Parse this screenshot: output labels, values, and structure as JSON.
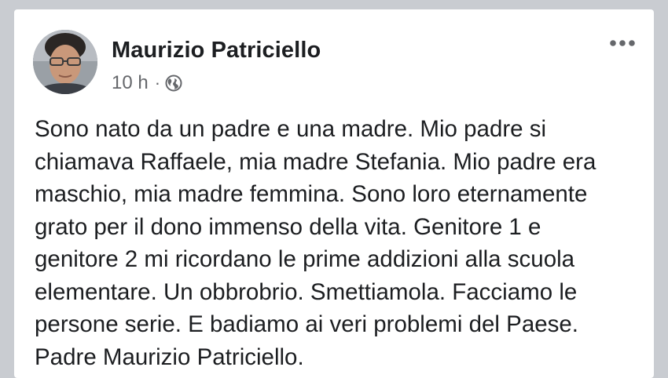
{
  "post": {
    "author": "Maurizio Patriciello",
    "timestamp": "10 h",
    "separator": "·",
    "audience_icon": "globe-icon",
    "more_icon": "more-options-icon",
    "avatar_icon": "profile-photo",
    "text_lines": [
      "Sono nato da un padre e una madre. Mio padre si",
      "chiamava Raffaele, mia madre Stefania. Mio padre era",
      "maschio, mia madre femmina. Sono loro eternamente",
      "grato per il dono immenso della vita. Genitore 1 e",
      "genitore 2 mi ricordano le prime addizioni alla scuola",
      "elementare. Un obbrobrio. Smettiamola. Facciamo le",
      "persone serie. E badiamo ai veri problemi del Paese.",
      "Padre Maurizio Patriciello."
    ]
  },
  "colors": {
    "background": "#c9ccd1",
    "card": "#ffffff",
    "text_primary": "#1c1e21",
    "text_secondary": "#65676b"
  }
}
